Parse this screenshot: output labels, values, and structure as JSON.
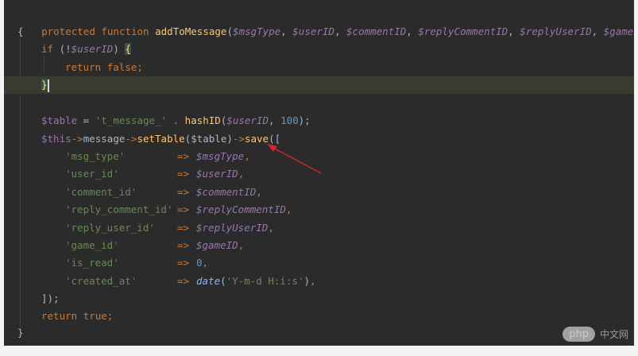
{
  "code": {
    "l1": {
      "kw1": "protected",
      "kw2": "function",
      "fn": "addToMessage",
      "p_open": "(",
      "a1": "$msgType",
      "a2": "$userID",
      "a3": "$commentID",
      "a4": "$replyCommentID",
      "a5": "$replyUserID",
      "a6": "$gameID",
      "p_close": ")",
      "sep": ", "
    },
    "l2": "{",
    "l3": {
      "kw": "if",
      "open": " (!",
      "var": "$userID",
      "close": ")",
      "brace": "{"
    },
    "l4": {
      "kw": "return",
      "val": "false",
      "semi": ";"
    },
    "l5": {
      "brace": "}"
    },
    "l7": {
      "var": "$table",
      "eq": " = ",
      "str": "'t_message_'",
      "dot": " . ",
      "fn": "hashID",
      "open": "(",
      "arg": "$userID",
      "comma": ", ",
      "num": "100",
      "close": ");"
    },
    "l8": {
      "this": "$this",
      "arrow1": "->",
      "prop": "message",
      "arrow2": "->",
      "m1": "setTable",
      "args1": "($table)",
      "arrow3": "->",
      "m2": "save",
      "open": "(["
    },
    "rows": [
      {
        "key": "'msg_type'",
        "arrow": "=>",
        "val": "$msgType",
        "tail": ","
      },
      {
        "key": "'user_id'",
        "arrow": "=>",
        "val": "$userID",
        "tail": ","
      },
      {
        "key": "'comment_id'",
        "arrow": "=>",
        "val": "$commentID",
        "tail": ","
      },
      {
        "key": "'reply_comment_id'",
        "arrow": "=>",
        "val": "$replyCommentID",
        "tail": ","
      },
      {
        "key": "'reply_user_id'",
        "arrow": "=>",
        "val": "$replyUserID",
        "tail": ","
      },
      {
        "key": "'game_id'",
        "arrow": "=>",
        "val": "$gameID",
        "tail": ","
      },
      {
        "key": "'is_read'",
        "arrow": "=>",
        "val": "0",
        "tail": ","
      },
      {
        "key": "'created_at'",
        "arrow": "=>",
        "fn": "date",
        "open": "(",
        "str": "'Y-m-d H:i:s'",
        "close": ")",
        "tail": ","
      }
    ],
    "l17": "]);",
    "l18": {
      "kw": "return",
      "val": "true",
      "semi": ";"
    },
    "l19": "}"
  },
  "annotation_color": "#d0262e",
  "watermark": {
    "badge": "php",
    "text": "中文网"
  }
}
